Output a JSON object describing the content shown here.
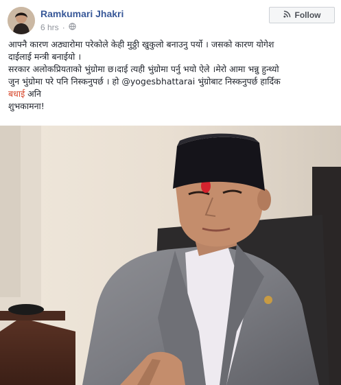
{
  "author": {
    "name": "Ramkumari Jhakri"
  },
  "meta": {
    "time": "6 hrs",
    "sep": "·",
    "privacy_icon": "globe-icon"
  },
  "follow": {
    "label": "Follow",
    "icon": "rss-icon"
  },
  "post": {
    "line1": "आफ्नै कारण अठ्यारोमा परेकोले केही मुठ्ठी खुकुलो बनाउनु पर्यो । जसको कारण योगेश",
    "line2": "दाईलाई मन्त्री बनाईयो ।",
    "line3": "सरकार अलोकप्रियताको भुंग्रोमा छ।दाई त्यही भुंग्रोमा पर्नु भयो ऐले ।मेरो आमा भन्नु हुन्थ्यो",
    "line4": "जुन भुंग्रोमा परे पनि निस्कनुपर्छ । हो @yogesbhattarai भुंग्रोबाट निस्कनुपर्छ हार्दिक",
    "line5_red": "बधाई",
    "line5_rest": " अनि",
    "line6": "शुभकामना!"
  },
  "colors": {
    "link": "#385898",
    "highlight": "#d7462a",
    "text": "#1d2129",
    "meta": "#90949c"
  }
}
